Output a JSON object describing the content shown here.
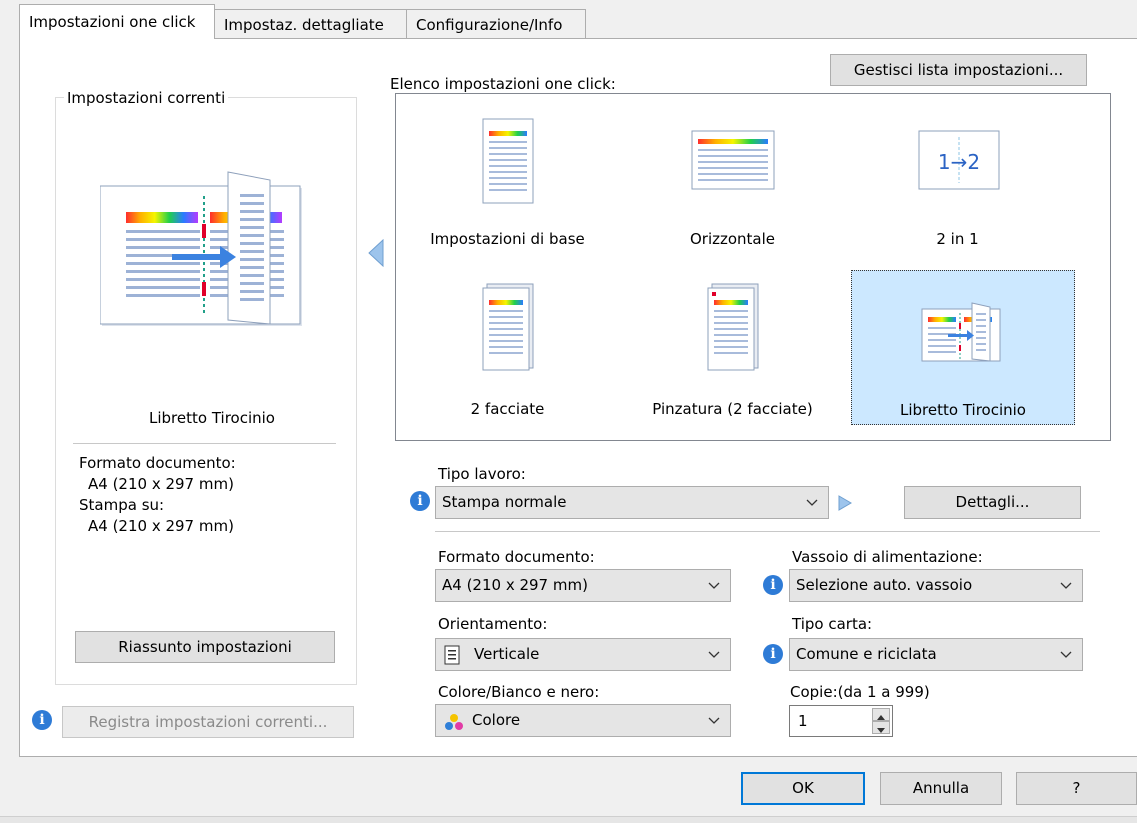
{
  "tabs": [
    {
      "label": "Impostazioni one click"
    },
    {
      "label": "Impostaz. dettagliate"
    },
    {
      "label": "Configurazione/Info"
    }
  ],
  "current": {
    "group_title": "Impostazioni correnti",
    "preset_name": "Libretto Tirocinio",
    "doc_size_label": "Formato documento:",
    "doc_size_value": "A4 (210 x 297 mm)",
    "print_on_label": "Stampa su:",
    "print_on_value": "A4 (210 x 297 mm)",
    "summary_button": "Riassunto impostazioni"
  },
  "register_button": "Registra impostazioni correnti...",
  "manage_button": "Gestisci lista impostazioni...",
  "list_title": "Elenco impostazioni one click:",
  "presets": [
    {
      "label": "Impostazioni di base"
    },
    {
      "label": "Orizzontale"
    },
    {
      "label": "2 in 1",
      "icon_text": "1→2"
    },
    {
      "label": "2 facciate"
    },
    {
      "label": "Pinzatura (2 facciate)"
    },
    {
      "label": "Libretto Tirocinio",
      "selected": true
    }
  ],
  "job_type": {
    "label": "Tipo lavoro:",
    "value": "Stampa normale",
    "details_button": "Dettagli..."
  },
  "doc_format": {
    "label": "Formato documento:",
    "value": "A4 (210 x 297 mm)"
  },
  "tray": {
    "label": "Vassoio di alimentazione:",
    "value": "Selezione auto. vassoio"
  },
  "orientation": {
    "label": "Orientamento:",
    "value": "Verticale"
  },
  "paper_type": {
    "label": "Tipo carta:",
    "value": "Comune e riciclata"
  },
  "color_mode": {
    "label": "Colore/Bianco e nero:",
    "value": "Colore"
  },
  "copies": {
    "label": "Copie:(da 1 a 999)",
    "value": "1"
  },
  "dialog": {
    "ok": "OK",
    "cancel": "Annulla",
    "help": "?"
  },
  "colors": {
    "accent": "#0078d7",
    "selected_tile": "#cce8ff",
    "info": "#2e7bd6"
  }
}
